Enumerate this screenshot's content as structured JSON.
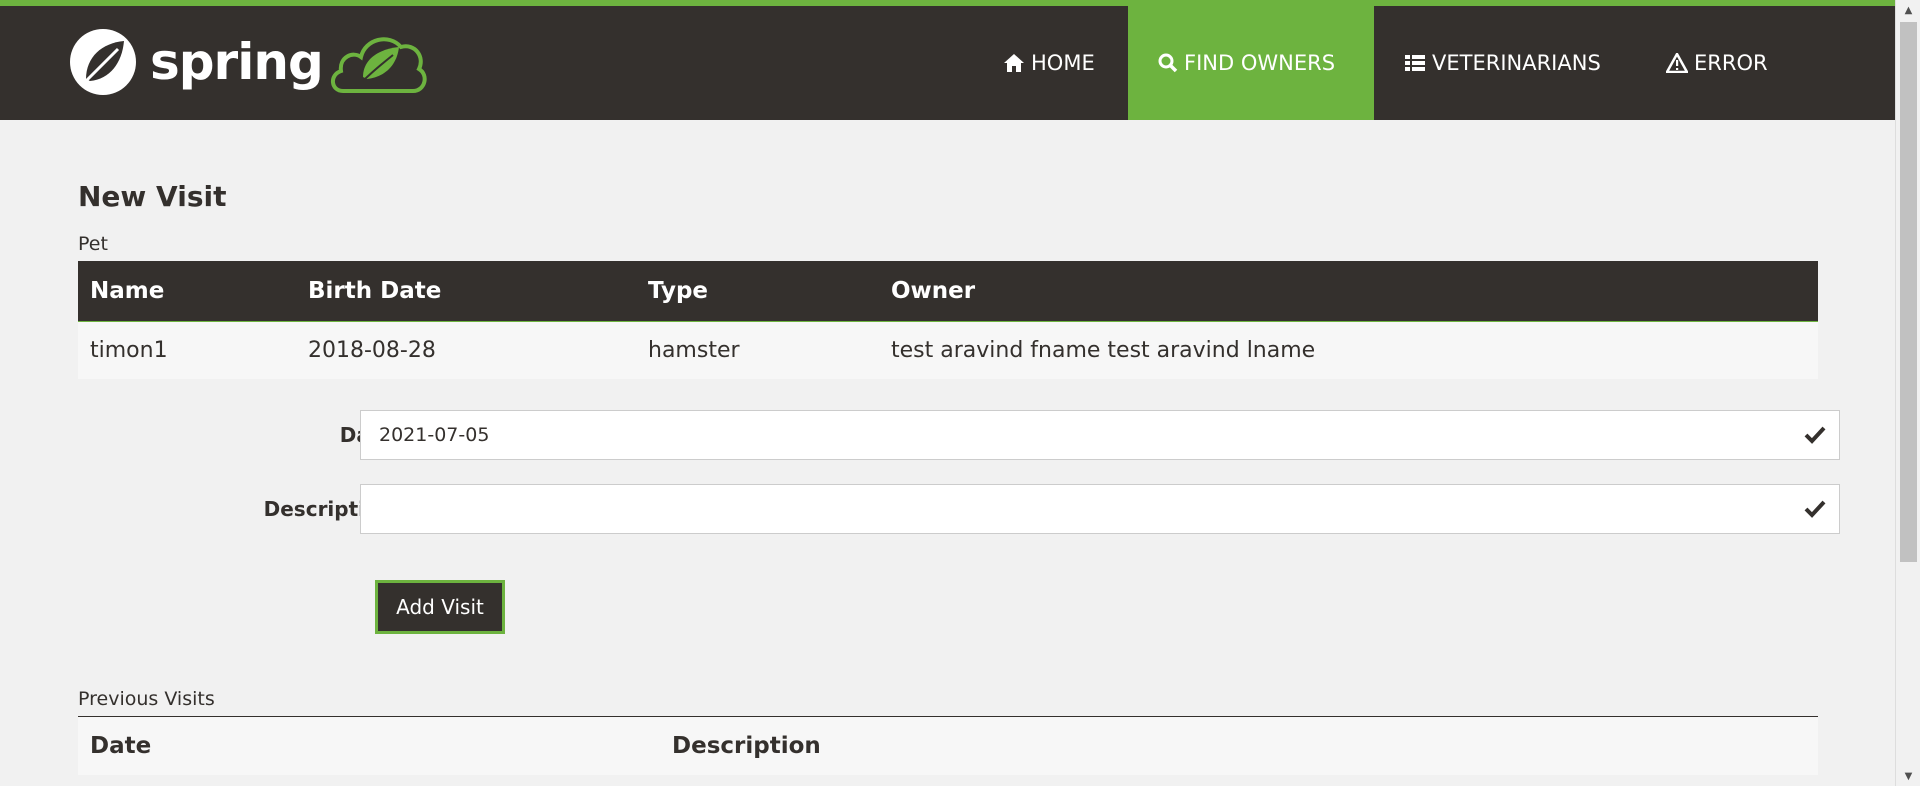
{
  "nav": {
    "brand": "spring",
    "items": [
      {
        "label": "HOME",
        "icon": "home-icon",
        "active": false
      },
      {
        "label": "FIND OWNERS",
        "icon": "search-icon",
        "active": true
      },
      {
        "label": "VETERINARIANS",
        "icon": "list-icon",
        "active": false
      },
      {
        "label": "ERROR",
        "icon": "warning-icon",
        "active": false
      }
    ]
  },
  "page": {
    "title": "New Visit",
    "pet_label": "Pet",
    "pet_table": {
      "headers": [
        "Name",
        "Birth Date",
        "Type",
        "Owner"
      ],
      "row": [
        "timon1",
        "2018-08-28",
        "hamster",
        "test aravind fname test aravind lname"
      ]
    },
    "form": {
      "date_label": "Date",
      "date_value": "2021-07-05",
      "description_label": "Description",
      "description_value": "",
      "submit_label": "Add Visit"
    },
    "previous_label": "Previous Visits",
    "visits_table": {
      "headers": [
        "Date",
        "Description"
      ]
    }
  },
  "colors": {
    "brand_green": "#6db33f",
    "dark": "#34302d",
    "background": "#f1f1f1"
  }
}
